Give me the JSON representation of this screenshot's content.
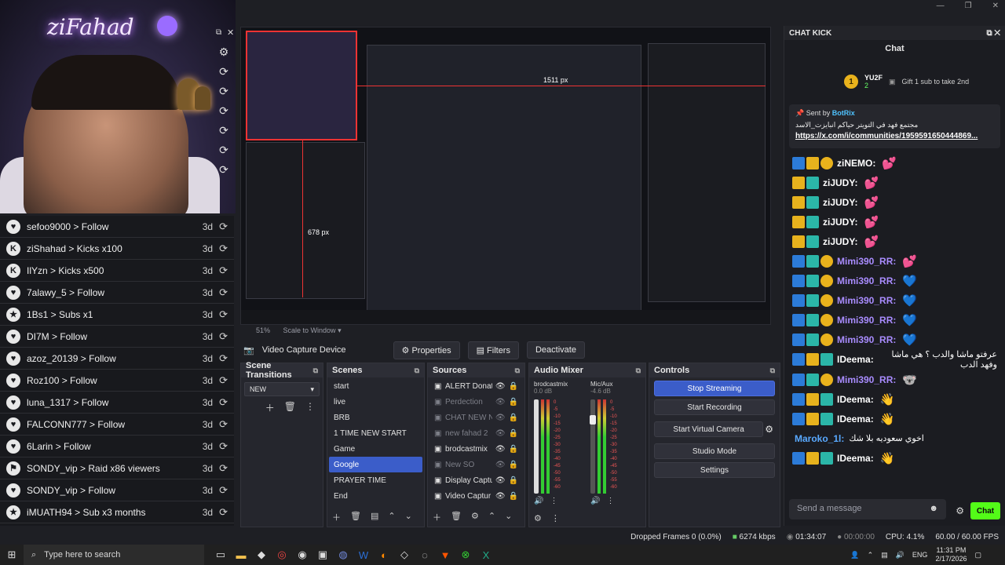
{
  "window_controls": [
    "—",
    "❐",
    "✕"
  ],
  "camera": {
    "logo": "ziFahad"
  },
  "alerts": [
    {
      "icon": "♥",
      "text": "sefoo9000 > Follow",
      "time": "3d"
    },
    {
      "icon": "K",
      "text": "ziShahad > Kicks x100",
      "time": "3d"
    },
    {
      "icon": "K",
      "text": "IlYzn > Kicks x500",
      "time": "3d"
    },
    {
      "icon": "♥",
      "text": "7alawy_5 > Follow",
      "time": "3d"
    },
    {
      "icon": "★",
      "text": "1Bs1 > Subs x1",
      "time": "3d"
    },
    {
      "icon": "♥",
      "text": "DI7M > Follow",
      "time": "3d"
    },
    {
      "icon": "♥",
      "text": "azoz_20139 > Follow",
      "time": "3d"
    },
    {
      "icon": "♥",
      "text": "Roz100 > Follow",
      "time": "3d"
    },
    {
      "icon": "♥",
      "text": "luna_1317 > Follow",
      "time": "3d"
    },
    {
      "icon": "♥",
      "text": "FALCONN777 > Follow",
      "time": "3d"
    },
    {
      "icon": "♥",
      "text": "6Larin > Follow",
      "time": "3d"
    },
    {
      "icon": "⚑",
      "text": "SONDY_vip > Raid x86 viewers",
      "time": "3d"
    },
    {
      "icon": "♥",
      "text": "SONDY_vip > Follow",
      "time": "3d"
    },
    {
      "icon": "★",
      "text": "iMUATH94 > Sub x3 months",
      "time": "3d"
    }
  ],
  "preview": {
    "zoom": "51%",
    "scale_mode": "Scale to Window",
    "measure_w": "1511 px",
    "measure_h": "678 px"
  },
  "source_toolbar": {
    "source_name": "Video Capture Device",
    "properties": "Properties",
    "filters": "Filters",
    "deactivate": "Deactivate"
  },
  "scene_transitions": {
    "title": "Scene Transitions",
    "selected": "NEW"
  },
  "scenes": {
    "title": "Scenes",
    "items": [
      "start",
      "live",
      "BRB",
      "1 TIME NEW START",
      "Game",
      "Google",
      "PRAYER TIME",
      "End"
    ],
    "selected_index": 5
  },
  "sources": {
    "title": "Sources",
    "items": [
      {
        "name": "ALERT Donatic",
        "visible": true
      },
      {
        "name": "Perdection",
        "visible": false
      },
      {
        "name": "CHAT NEW NE",
        "visible": false
      },
      {
        "name": "new fahad 2",
        "visible": false
      },
      {
        "name": "brodcastmix",
        "visible": true
      },
      {
        "name": "New SO",
        "visible": false
      },
      {
        "name": "Display Captur",
        "visible": true
      },
      {
        "name": "Video Captur",
        "visible": true
      }
    ]
  },
  "audio_mixer": {
    "title": "Audio Mixer",
    "channels": [
      {
        "name": "brodcastmix",
        "db": "0.0 dB"
      },
      {
        "name": "Mic/Aux",
        "db": "-4.6 dB"
      }
    ],
    "scale": [
      "0",
      "-5",
      "-10",
      "-15",
      "-20",
      "-25",
      "-30",
      "-35",
      "-40",
      "-45",
      "-50",
      "-55",
      "-60"
    ]
  },
  "controls": {
    "title": "Controls",
    "buttons": [
      "Stop Streaming",
      "Start Recording",
      "Start Virtual Camera",
      "Studio Mode",
      "Settings"
    ]
  },
  "chat": {
    "dock_title": "CHAT KICK",
    "title": "Chat",
    "gift_user": "YU2F",
    "gift_count": "2",
    "gift_text": "Gift 1 sub to take 2nd",
    "pinned_from": "Sent by",
    "pinned_user": "BotRix",
    "pinned_msg": "مجتمع فهد في التويتر حياكم انبايزت_الاسد",
    "pinned_link": "https://x.com/i/communities/1959591650444869...",
    "messages": [
      {
        "badges": [
          "blue",
          "gold",
          "coin2"
        ],
        "user": "ziNEMO:",
        "color": "white",
        "emote": "💕"
      },
      {
        "badges": [
          "gold",
          "teal"
        ],
        "user": "ziJUDY:",
        "color": "white",
        "emote": "💕"
      },
      {
        "badges": [
          "gold",
          "teal"
        ],
        "user": "ziJUDY:",
        "color": "white",
        "emote": "💕"
      },
      {
        "badges": [
          "gold",
          "teal"
        ],
        "user": "ziJUDY:",
        "color": "white",
        "emote": "💕"
      },
      {
        "badges": [
          "gold",
          "teal"
        ],
        "user": "ziJUDY:",
        "color": "white",
        "emote": "💕"
      },
      {
        "badges": [
          "blue",
          "teal",
          "coin2"
        ],
        "user": "Mimi390_RR:",
        "color": "purple",
        "emote": "💕"
      },
      {
        "badges": [
          "blue",
          "teal",
          "coin2"
        ],
        "user": "Mimi390_RR:",
        "color": "purple",
        "emote": "💙"
      },
      {
        "badges": [
          "blue",
          "teal",
          "coin2"
        ],
        "user": "Mimi390_RR:",
        "color": "purple",
        "emote": "💙"
      },
      {
        "badges": [
          "blue",
          "teal",
          "coin2"
        ],
        "user": "Mimi390_RR:",
        "color": "purple",
        "emote": "💙"
      },
      {
        "badges": [
          "blue",
          "teal",
          "coin2"
        ],
        "user": "Mimi390_RR:",
        "color": "purple",
        "emote": "💙"
      },
      {
        "badges": [
          "blue",
          "gold",
          "teal"
        ],
        "user": "IDeema:",
        "color": "white",
        "text": "عرفتو ماشا والدب ؟ هي ماشا وفهد الدب"
      },
      {
        "badges": [
          "blue",
          "teal",
          "coin2"
        ],
        "user": "Mimi390_RR:",
        "color": "purple",
        "emote": "🐨"
      },
      {
        "badges": [
          "blue",
          "gold",
          "teal"
        ],
        "user": "IDeema:",
        "color": "white",
        "emote": "👋"
      },
      {
        "badges": [
          "blue",
          "gold",
          "teal"
        ],
        "user": "IDeema:",
        "color": "white",
        "emote": "👋"
      },
      {
        "badges": [],
        "user": "Maroko_1l:",
        "color": "blue2",
        "text": "اخوي سعوديه بلا شك"
      },
      {
        "badges": [
          "blue",
          "gold",
          "teal"
        ],
        "user": "IDeema:",
        "color": "white",
        "emote": "👋"
      }
    ],
    "input_placeholder": "Send a message",
    "send_label": "Chat"
  },
  "status_bar": {
    "dropped": "Dropped Frames 0 (0.0%)",
    "bitrate": "6274 kbps",
    "live_time": "01:34:07",
    "rec_time": "00:00:00",
    "cpu": "CPU: 4.1%",
    "fps": "60.00 / 60.00 FPS"
  },
  "taskbar": {
    "search_placeholder": "Type here to search",
    "language": "ENG",
    "time": "11:31 PM",
    "date": "2/17/2026"
  }
}
